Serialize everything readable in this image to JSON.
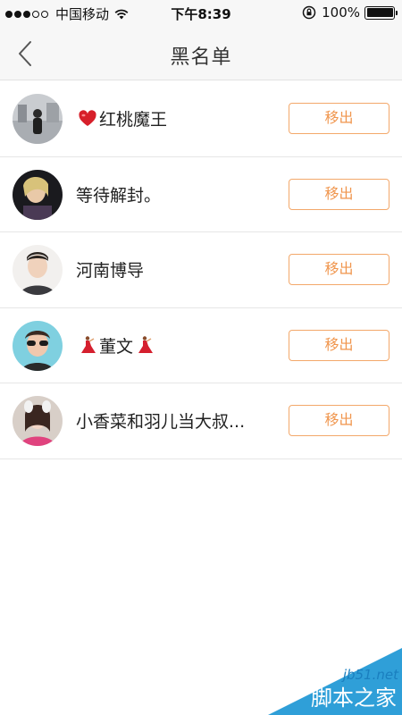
{
  "status_bar": {
    "carrier": "中国移动",
    "time": "下午8:39",
    "battery": "100%"
  },
  "nav": {
    "title": "黑名单"
  },
  "blacklist": [
    {
      "name": "红桃魔王",
      "button": "移出"
    },
    {
      "name": "等待解封。",
      "button": "移出"
    },
    {
      "name": "河南博导",
      "button": "移出"
    },
    {
      "name": "董文",
      "button": "移出"
    },
    {
      "name": "小香菜和羽儿当大叔...",
      "button": "移出"
    }
  ],
  "watermark": {
    "site": "jb51.net",
    "text": "脚本之家"
  },
  "colors": {
    "accent": "#f0964e",
    "bar_bg": "#f7f7f7"
  }
}
